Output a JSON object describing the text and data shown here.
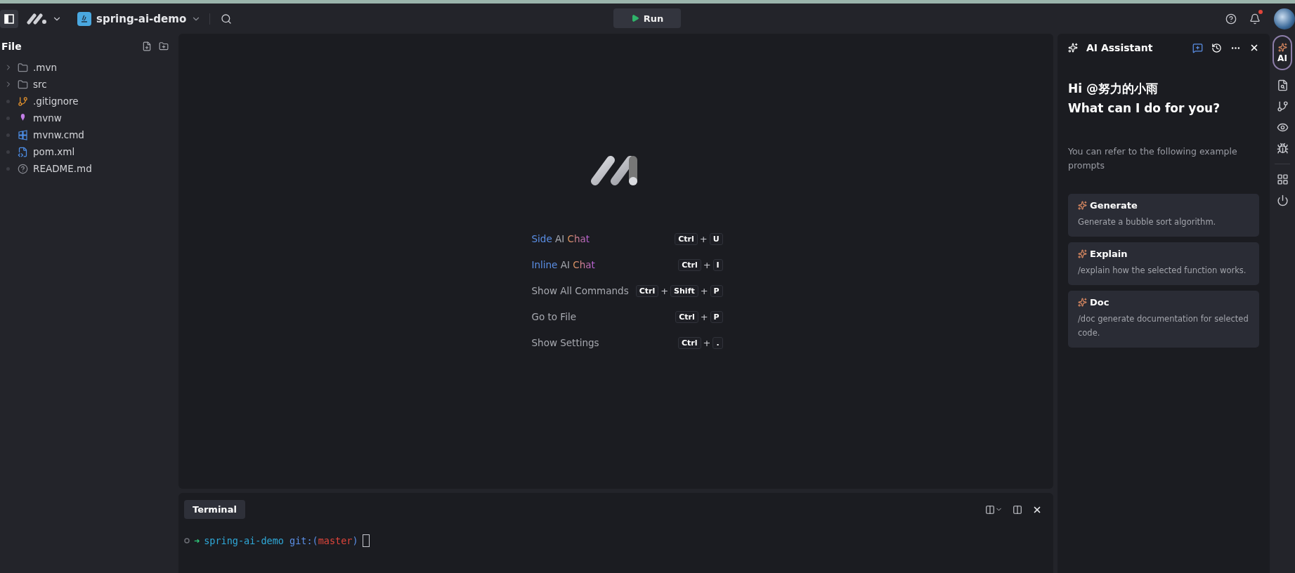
{
  "topbar": {
    "project": "spring-ai-demo",
    "run": "Run",
    "notification": true
  },
  "explorer": {
    "title": "File",
    "items": [
      {
        "name": ".mvn",
        "kind": "folder",
        "expanded": false
      },
      {
        "name": "src",
        "kind": "folder",
        "expanded": false
      },
      {
        "name": ".gitignore",
        "kind": "git"
      },
      {
        "name": "mvnw",
        "kind": "script"
      },
      {
        "name": "mvnw.cmd",
        "kind": "cmd"
      },
      {
        "name": "pom.xml",
        "kind": "xml"
      },
      {
        "name": "README.md",
        "kind": "markdown"
      }
    ]
  },
  "shortcuts": [
    {
      "label": [
        {
          "text": "Side",
          "kind": "blue"
        },
        {
          "text": "AI",
          "kind": "gray"
        },
        {
          "text": "Chat",
          "kind": "gradient"
        }
      ],
      "keys": [
        {
          "kind": "key",
          "text": "Ctrl"
        },
        {
          "kind": "plus",
          "text": "+"
        },
        {
          "kind": "key",
          "text": "U"
        }
      ]
    },
    {
      "label": [
        {
          "text": "Inline",
          "kind": "blue"
        },
        {
          "text": "AI",
          "kind": "gray"
        },
        {
          "text": "Chat",
          "kind": "gradient"
        }
      ],
      "keys": [
        {
          "kind": "key",
          "text": "Ctrl"
        },
        {
          "kind": "plus",
          "text": "+"
        },
        {
          "kind": "key",
          "text": "I"
        }
      ]
    },
    {
      "label": [
        {
          "text": "Show All Commands",
          "kind": "gray"
        }
      ],
      "keys": [
        {
          "kind": "key",
          "text": "Ctrl"
        },
        {
          "kind": "plus",
          "text": "+"
        },
        {
          "kind": "key",
          "text": "Shift"
        },
        {
          "kind": "plus",
          "text": "+"
        },
        {
          "kind": "key",
          "text": "P"
        }
      ]
    },
    {
      "label": [
        {
          "text": "Go to File",
          "kind": "gray"
        }
      ],
      "keys": [
        {
          "kind": "key",
          "text": "Ctrl"
        },
        {
          "kind": "plus",
          "text": "+"
        },
        {
          "kind": "key",
          "text": "P"
        }
      ]
    },
    {
      "label": [
        {
          "text": "Show Settings",
          "kind": "gray"
        }
      ],
      "keys": [
        {
          "kind": "key",
          "text": "Ctrl"
        },
        {
          "kind": "plus",
          "text": "+"
        },
        {
          "kind": "key",
          "text": "."
        }
      ]
    }
  ],
  "terminal": {
    "tab": "Terminal",
    "prompt_arrow": "➜",
    "prompt": [
      {
        "text": "spring-ai-demo",
        "kind": "cyan"
      },
      {
        "text": " git:(",
        "kind": "blue"
      },
      {
        "text": "master",
        "kind": "red"
      },
      {
        "text": ")",
        "kind": "blue"
      }
    ]
  },
  "assistant": {
    "title": "AI Assistant",
    "greeting": "Hi @努力的小雨",
    "question": "What can I do for you?",
    "hint": "You can refer to the following example prompts",
    "prompts": [
      {
        "title": "Generate",
        "text": "Generate a bubble sort algorithm."
      },
      {
        "title": "Explain",
        "text": "/explain how the selected function works."
      },
      {
        "title": "Doc",
        "text": "/doc generate documentation for selected code."
      }
    ]
  },
  "rail": {
    "ai_tab": {
      "label": "AI",
      "selected": true
    }
  }
}
